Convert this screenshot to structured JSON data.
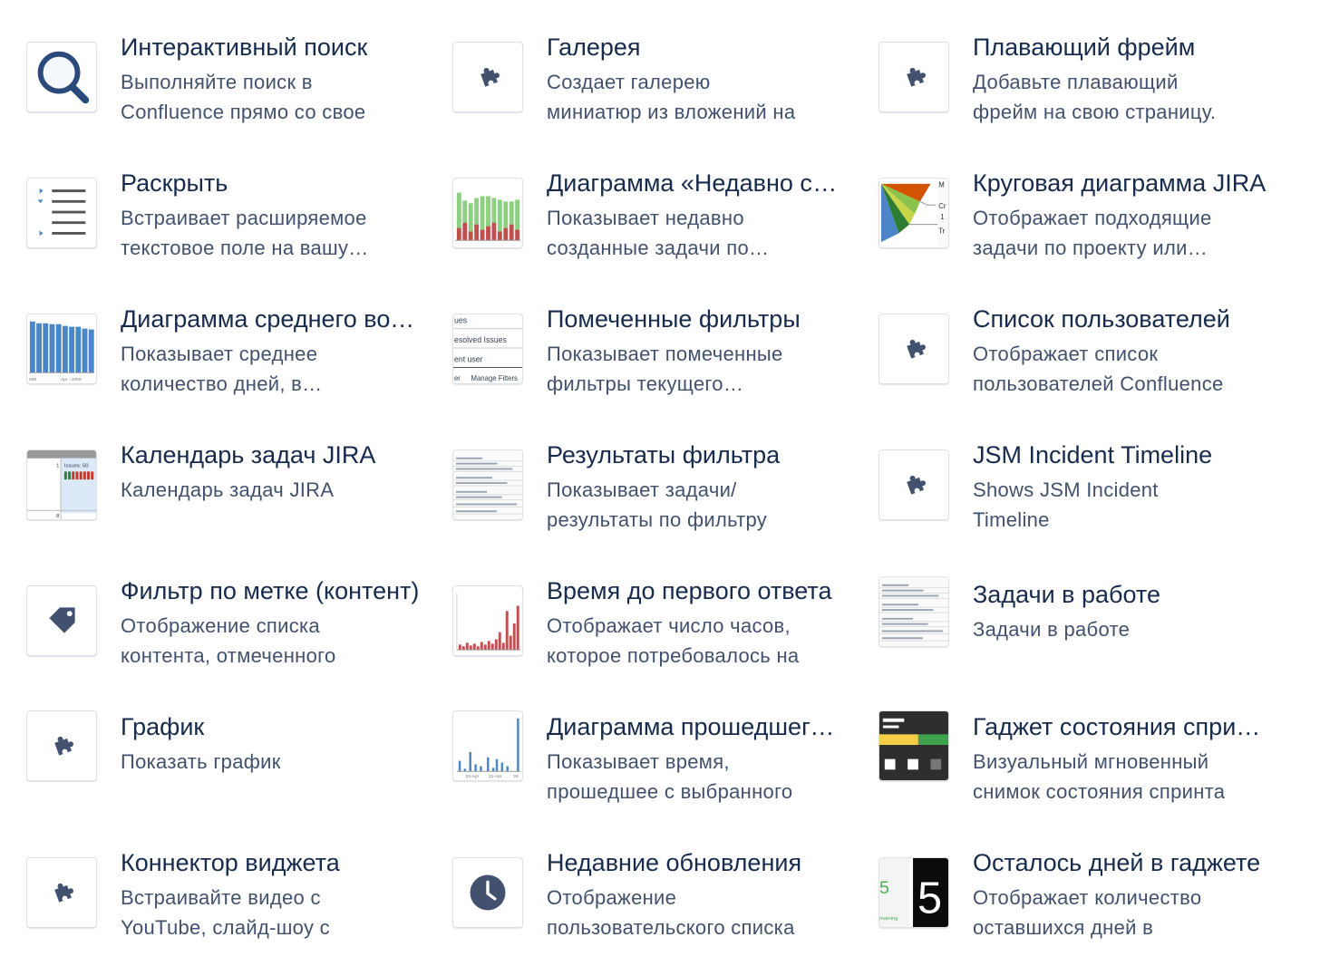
{
  "macros": [
    {
      "name": "interactive-search",
      "icon": "magnifier-icon",
      "title": "Интерактивный поиск",
      "description": "Выполняйте поиск в Confluence прямо со свое"
    },
    {
      "name": "gallery",
      "icon": "puzzle-icon",
      "title": "Галерея",
      "description": "Создает галерею миниатюр из вложений на"
    },
    {
      "name": "floating-frame",
      "icon": "puzzle-icon",
      "title": "Плавающий фрейм",
      "description": "Добавьте плавающий фрейм на свою страницу."
    },
    {
      "name": "expand",
      "icon": "list-icon",
      "title": "Раскрыть",
      "description": "Встраивает расширяемое текстовое поле на вашу страницу"
    },
    {
      "name": "recently-created-chart",
      "icon": "stacked-bar-chart-icon",
      "title": "Диаграмма «Недавно созданные»",
      "description": "Показывает недавно созданные задачи по проекту"
    },
    {
      "name": "pie-chart",
      "icon": "pie-chart-icon",
      "title": "Круговая диаграмма JIRA",
      "description": "Отображает подходящие задачи по проекту или фильтру"
    },
    {
      "name": "average-age-chart",
      "icon": "bar-chart-icon",
      "title": "Диаграмма среднего возраста",
      "description": "Показывает среднее количество дней, в течение"
    },
    {
      "name": "favourite-filters",
      "icon": "filters-list-icon",
      "title": "Помеченные фильтры",
      "description": "Показывает помеченные фильтры текущего пользователя"
    },
    {
      "name": "user-list",
      "icon": "puzzle-icon",
      "title": "Список пользователей",
      "description": "Отображает список пользователей Confluence"
    },
    {
      "name": "jira-issues-calendar",
      "icon": "calendar-icon",
      "title": "Календарь задач JIRA",
      "description": "Календарь задач JIRA"
    },
    {
      "name": "filter-results",
      "icon": "table-icon",
      "title": "Результаты фильтра",
      "description": "Показывает задачи/ результаты по фильтру"
    },
    {
      "name": "jsm-incident-timeline",
      "icon": "puzzle-icon",
      "title": "JSM Incident Timeline",
      "description": "Shows JSM Incident Timeline"
    },
    {
      "name": "content-by-label",
      "icon": "tag-icon",
      "title": "Фильтр по метке (контент)",
      "description": "Отображение списка контента, отмеченного"
    },
    {
      "name": "time-to-first-response",
      "icon": "red-bar-chart-icon",
      "title": "Время до первого ответа",
      "description": "Отображает число часов, которое потребовалось на"
    },
    {
      "name": "issues-in-progress",
      "icon": "table-icon",
      "title": "Задачи в работе",
      "description": "Задачи в работе"
    },
    {
      "name": "chart",
      "icon": "puzzle-icon",
      "title": "График",
      "description": "Показать график"
    },
    {
      "name": "time-since-chart",
      "icon": "blue-bar-chart-icon",
      "title": "Диаграмма прошедшего времени",
      "description": "Показывает время, прошедшее с выбранного"
    },
    {
      "name": "sprint-health-gadget",
      "icon": "sprint-health-icon",
      "title": "Гаджет состояния спринта",
      "description": "Визуальный мгновенный снимок состояния спринта"
    },
    {
      "name": "widget-connector",
      "icon": "puzzle-icon",
      "title": "Коннектор виджета",
      "description": "Встраивайте видео с YouTube, слайд-шоу с"
    },
    {
      "name": "recently-updated",
      "icon": "clock-icon",
      "title": "Недавние обновления",
      "description": "Отображение пользовательского списка"
    },
    {
      "name": "days-left",
      "icon": "days-counter-icon",
      "title": "Осталось дней в гаджете",
      "description": "Отображает количество оставшихся дней в"
    }
  ],
  "thumb_text": {
    "filters": [
      "ues",
      "esolved Issues",
      "ent user",
      "er",
      "Manage Filters"
    ],
    "pie": [
      "M",
      "Cr",
      "1",
      "Tr"
    ],
    "calendar": [
      "1",
      "Issues: 50",
      "8"
    ],
    "days": [
      "5",
      "maining"
    ],
    "axis_avg": [
      "008",
      "Apr - 2009"
    ],
    "axis_time": [
      "24-Apr",
      "21-Apr",
      "26"
    ]
  },
  "colors": {
    "title": "#172b4d",
    "description": "#42526e",
    "icon": "#42526e",
    "chart_blue": "#4a86c8",
    "chart_green": "#8ed081",
    "chart_red": "#c0504d",
    "sprint_dark": "#2e2e2e",
    "sprint_yellow": "#f5cd47",
    "sprint_green": "#3fa34d"
  }
}
